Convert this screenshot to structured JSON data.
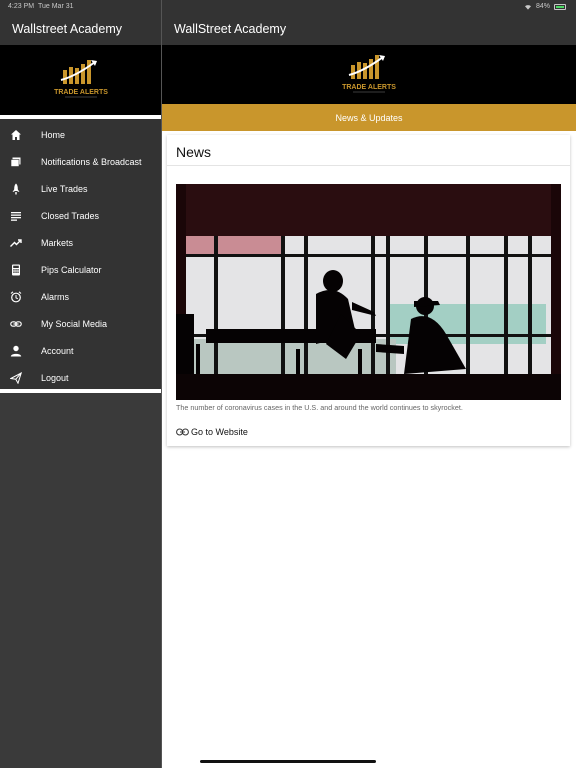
{
  "status_bar": {
    "time": "4:23 PM",
    "date": "Tue Mar 31",
    "battery": "84%"
  },
  "sidebar": {
    "title": "Wallstreet Academy",
    "logo_text": "TRADE ALERTS",
    "items": [
      {
        "label": "Home",
        "icon": "home-icon"
      },
      {
        "label": "Notifications & Broadcast",
        "icon": "notifications-icon"
      },
      {
        "label": "Live Trades",
        "icon": "rocket-icon"
      },
      {
        "label": "Closed Trades",
        "icon": "list-icon"
      },
      {
        "label": "Markets",
        "icon": "trending-up-icon"
      },
      {
        "label": "Pips Calculator",
        "icon": "calculator-icon"
      },
      {
        "label": "Alarms",
        "icon": "alarm-icon"
      },
      {
        "label": "My Social Media",
        "icon": "link-icon"
      },
      {
        "label": "Account",
        "icon": "person-icon"
      },
      {
        "label": "Logout",
        "icon": "send-icon"
      }
    ]
  },
  "main": {
    "title": "WallStreet Academy",
    "logo_text": "TRADE ALERTS",
    "tab_label": "News & Updates",
    "card": {
      "heading": "News",
      "caption": "The number of coronavirus cases in the U.S. and around the world continues to skyrocket.",
      "link_label": "Go to Website"
    }
  },
  "colors": {
    "accent": "#c9962c",
    "header": "#333333",
    "sidebar": "#3a3a3a"
  }
}
